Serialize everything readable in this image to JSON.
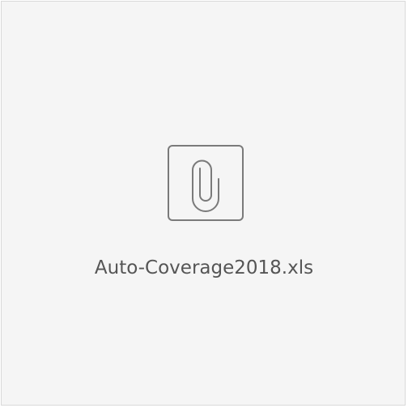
{
  "attachment": {
    "file_name": "Auto-Coverage2018.xls",
    "icon": "paperclip-icon"
  },
  "colors": {
    "card_background": "#f5f5f5",
    "card_border": "#d9d9d9",
    "icon_stroke": "#7a7a7a",
    "text": "#555555"
  }
}
